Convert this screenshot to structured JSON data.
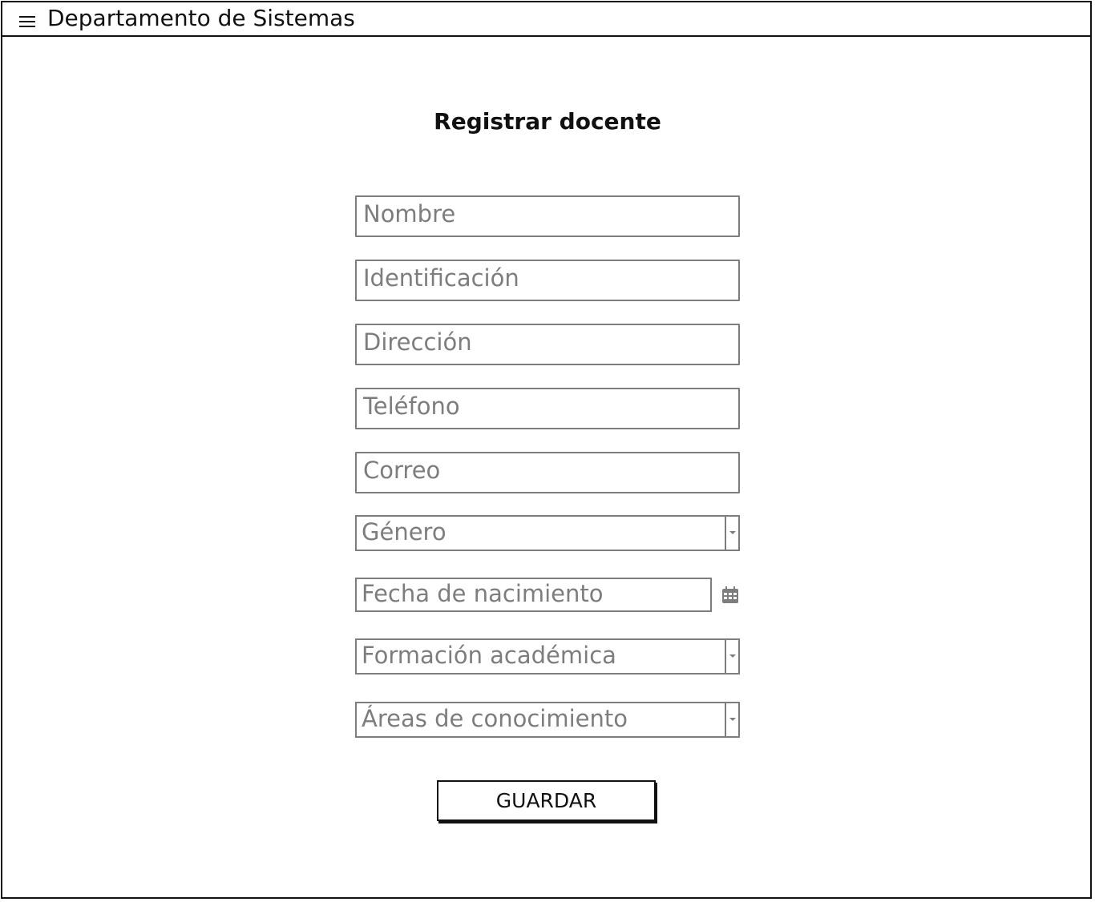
{
  "header": {
    "menu_icon": "hamburger-menu-icon",
    "title": "Departamento de Sistemas"
  },
  "form": {
    "title": "Registrar docente",
    "fields": {
      "nombre": {
        "placeholder": "Nombre",
        "value": ""
      },
      "identificacion": {
        "placeholder": "Identificación",
        "value": ""
      },
      "direccion": {
        "placeholder": "Dirección",
        "value": ""
      },
      "telefono": {
        "placeholder": "Teléfono",
        "value": ""
      },
      "correo": {
        "placeholder": "Correo",
        "value": ""
      }
    },
    "selects": {
      "genero": {
        "selected": "Género"
      },
      "formacion": {
        "selected": "Formación académica"
      },
      "areas": {
        "selected": "Áreas de conocimiento"
      }
    },
    "date": {
      "placeholder": "Fecha de nacimiento",
      "icon": "calendar-icon"
    },
    "save_label": "GUARDAR"
  },
  "colors": {
    "border": "#111111",
    "field_border": "#7d7d80",
    "placeholder_text": "#7d7d80"
  }
}
